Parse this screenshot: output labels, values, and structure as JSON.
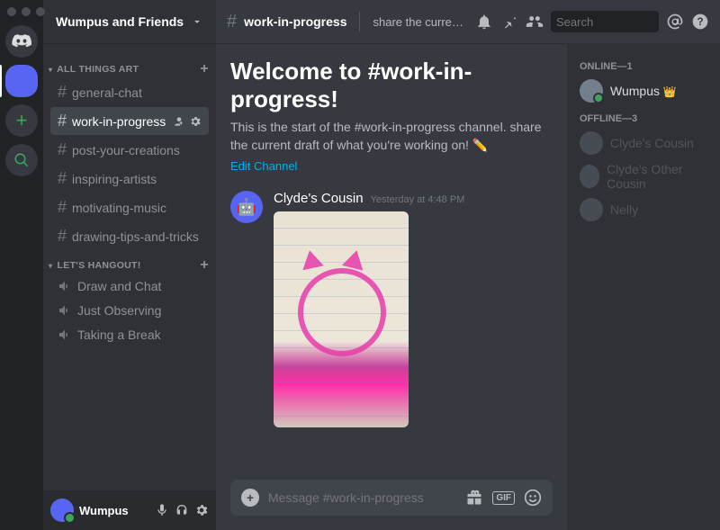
{
  "server": {
    "name": "Wumpus and Friends"
  },
  "categories": [
    {
      "label": "ALL THINGS ART",
      "channels": [
        {
          "name": "general-chat",
          "type": "text"
        },
        {
          "name": "work-in-progress",
          "type": "text",
          "active": true
        },
        {
          "name": "post-your-creations",
          "type": "text"
        },
        {
          "name": "inspiring-artists",
          "type": "text"
        },
        {
          "name": "motivating-music",
          "type": "text"
        },
        {
          "name": "drawing-tips-and-tricks",
          "type": "text"
        }
      ]
    },
    {
      "label": "LET'S HANGOUT!",
      "channels": [
        {
          "name": "Draw and Chat",
          "type": "voice"
        },
        {
          "name": "Just Observing",
          "type": "voice"
        },
        {
          "name": "Taking a Break",
          "type": "voice"
        }
      ]
    }
  ],
  "current_user": {
    "name": "Wumpus"
  },
  "header": {
    "channel": "work-in-progress",
    "topic": "share the current draft of wh…",
    "search_placeholder": "Search"
  },
  "welcome": {
    "title": "Welcome to #work-in-progress!",
    "subtitle": "This is the start of the #work-in-progress channel. share the current draft of what you're working on! ✏️",
    "edit_link": "Edit Channel"
  },
  "messages": [
    {
      "author": "Clyde's Cousin",
      "timestamp": "Yesterday at 4:48 PM"
    }
  ],
  "composer": {
    "placeholder": "Message #work-in-progress",
    "gif_label": "GIF"
  },
  "members": {
    "online_label": "ONLINE—1",
    "offline_label": "OFFLINE—3",
    "online": [
      {
        "name": "Wumpus",
        "owner": true
      }
    ],
    "offline": [
      {
        "name": "Clyde's Cousin"
      },
      {
        "name": "Clyde's Other Cousin"
      },
      {
        "name": "Nelly"
      }
    ]
  }
}
